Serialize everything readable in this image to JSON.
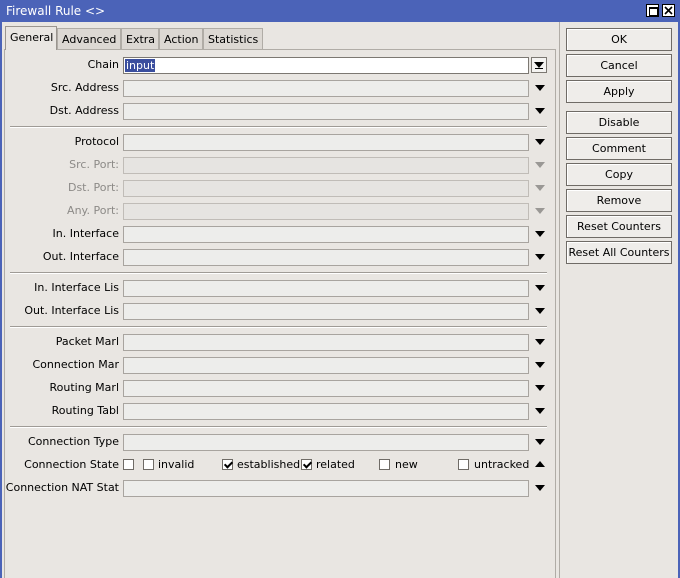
{
  "window": {
    "title": "Firewall Rule <>"
  },
  "tabs": [
    "General",
    "Advanced",
    "Extra",
    "Action",
    "Statistics"
  ],
  "fields": {
    "chain": {
      "label": "Chain",
      "value": "input"
    },
    "src_address": {
      "label": "Src. Address"
    },
    "dst_address": {
      "label": "Dst. Address"
    },
    "protocol": {
      "label": "Protocol"
    },
    "src_port": {
      "label": "Src. Port:"
    },
    "dst_port": {
      "label": "Dst. Port:"
    },
    "any_port": {
      "label": "Any. Port:"
    },
    "in_interface": {
      "label": "In. Interface"
    },
    "out_interface": {
      "label": "Out. Interface"
    },
    "in_interface_list": {
      "label": "In. Interface Lis"
    },
    "out_interface_list": {
      "label": "Out. Interface Lis"
    },
    "packet_mark": {
      "label": "Packet Marl"
    },
    "connection_mark": {
      "label": "Connection Mar"
    },
    "routing_mark": {
      "label": "Routing Marl"
    },
    "routing_table": {
      "label": "Routing Tabl"
    },
    "connection_type": {
      "label": "Connection Type"
    },
    "connection_state": {
      "label": "Connection State",
      "options": [
        {
          "label": "invalid",
          "checked": false
        },
        {
          "label": "established",
          "checked": true
        },
        {
          "label": "related",
          "checked": true
        },
        {
          "label": "new",
          "checked": false
        },
        {
          "label": "untracked",
          "checked": false
        }
      ]
    },
    "connection_nat_state": {
      "label": "Connection NAT Stat"
    }
  },
  "buttons": {
    "ok": "OK",
    "cancel": "Cancel",
    "apply": "Apply",
    "disable": "Disable",
    "comment": "Comment",
    "copy": "Copy",
    "remove": "Remove",
    "reset_counters": "Reset Counters",
    "reset_all_counters": "Reset All Counters"
  }
}
